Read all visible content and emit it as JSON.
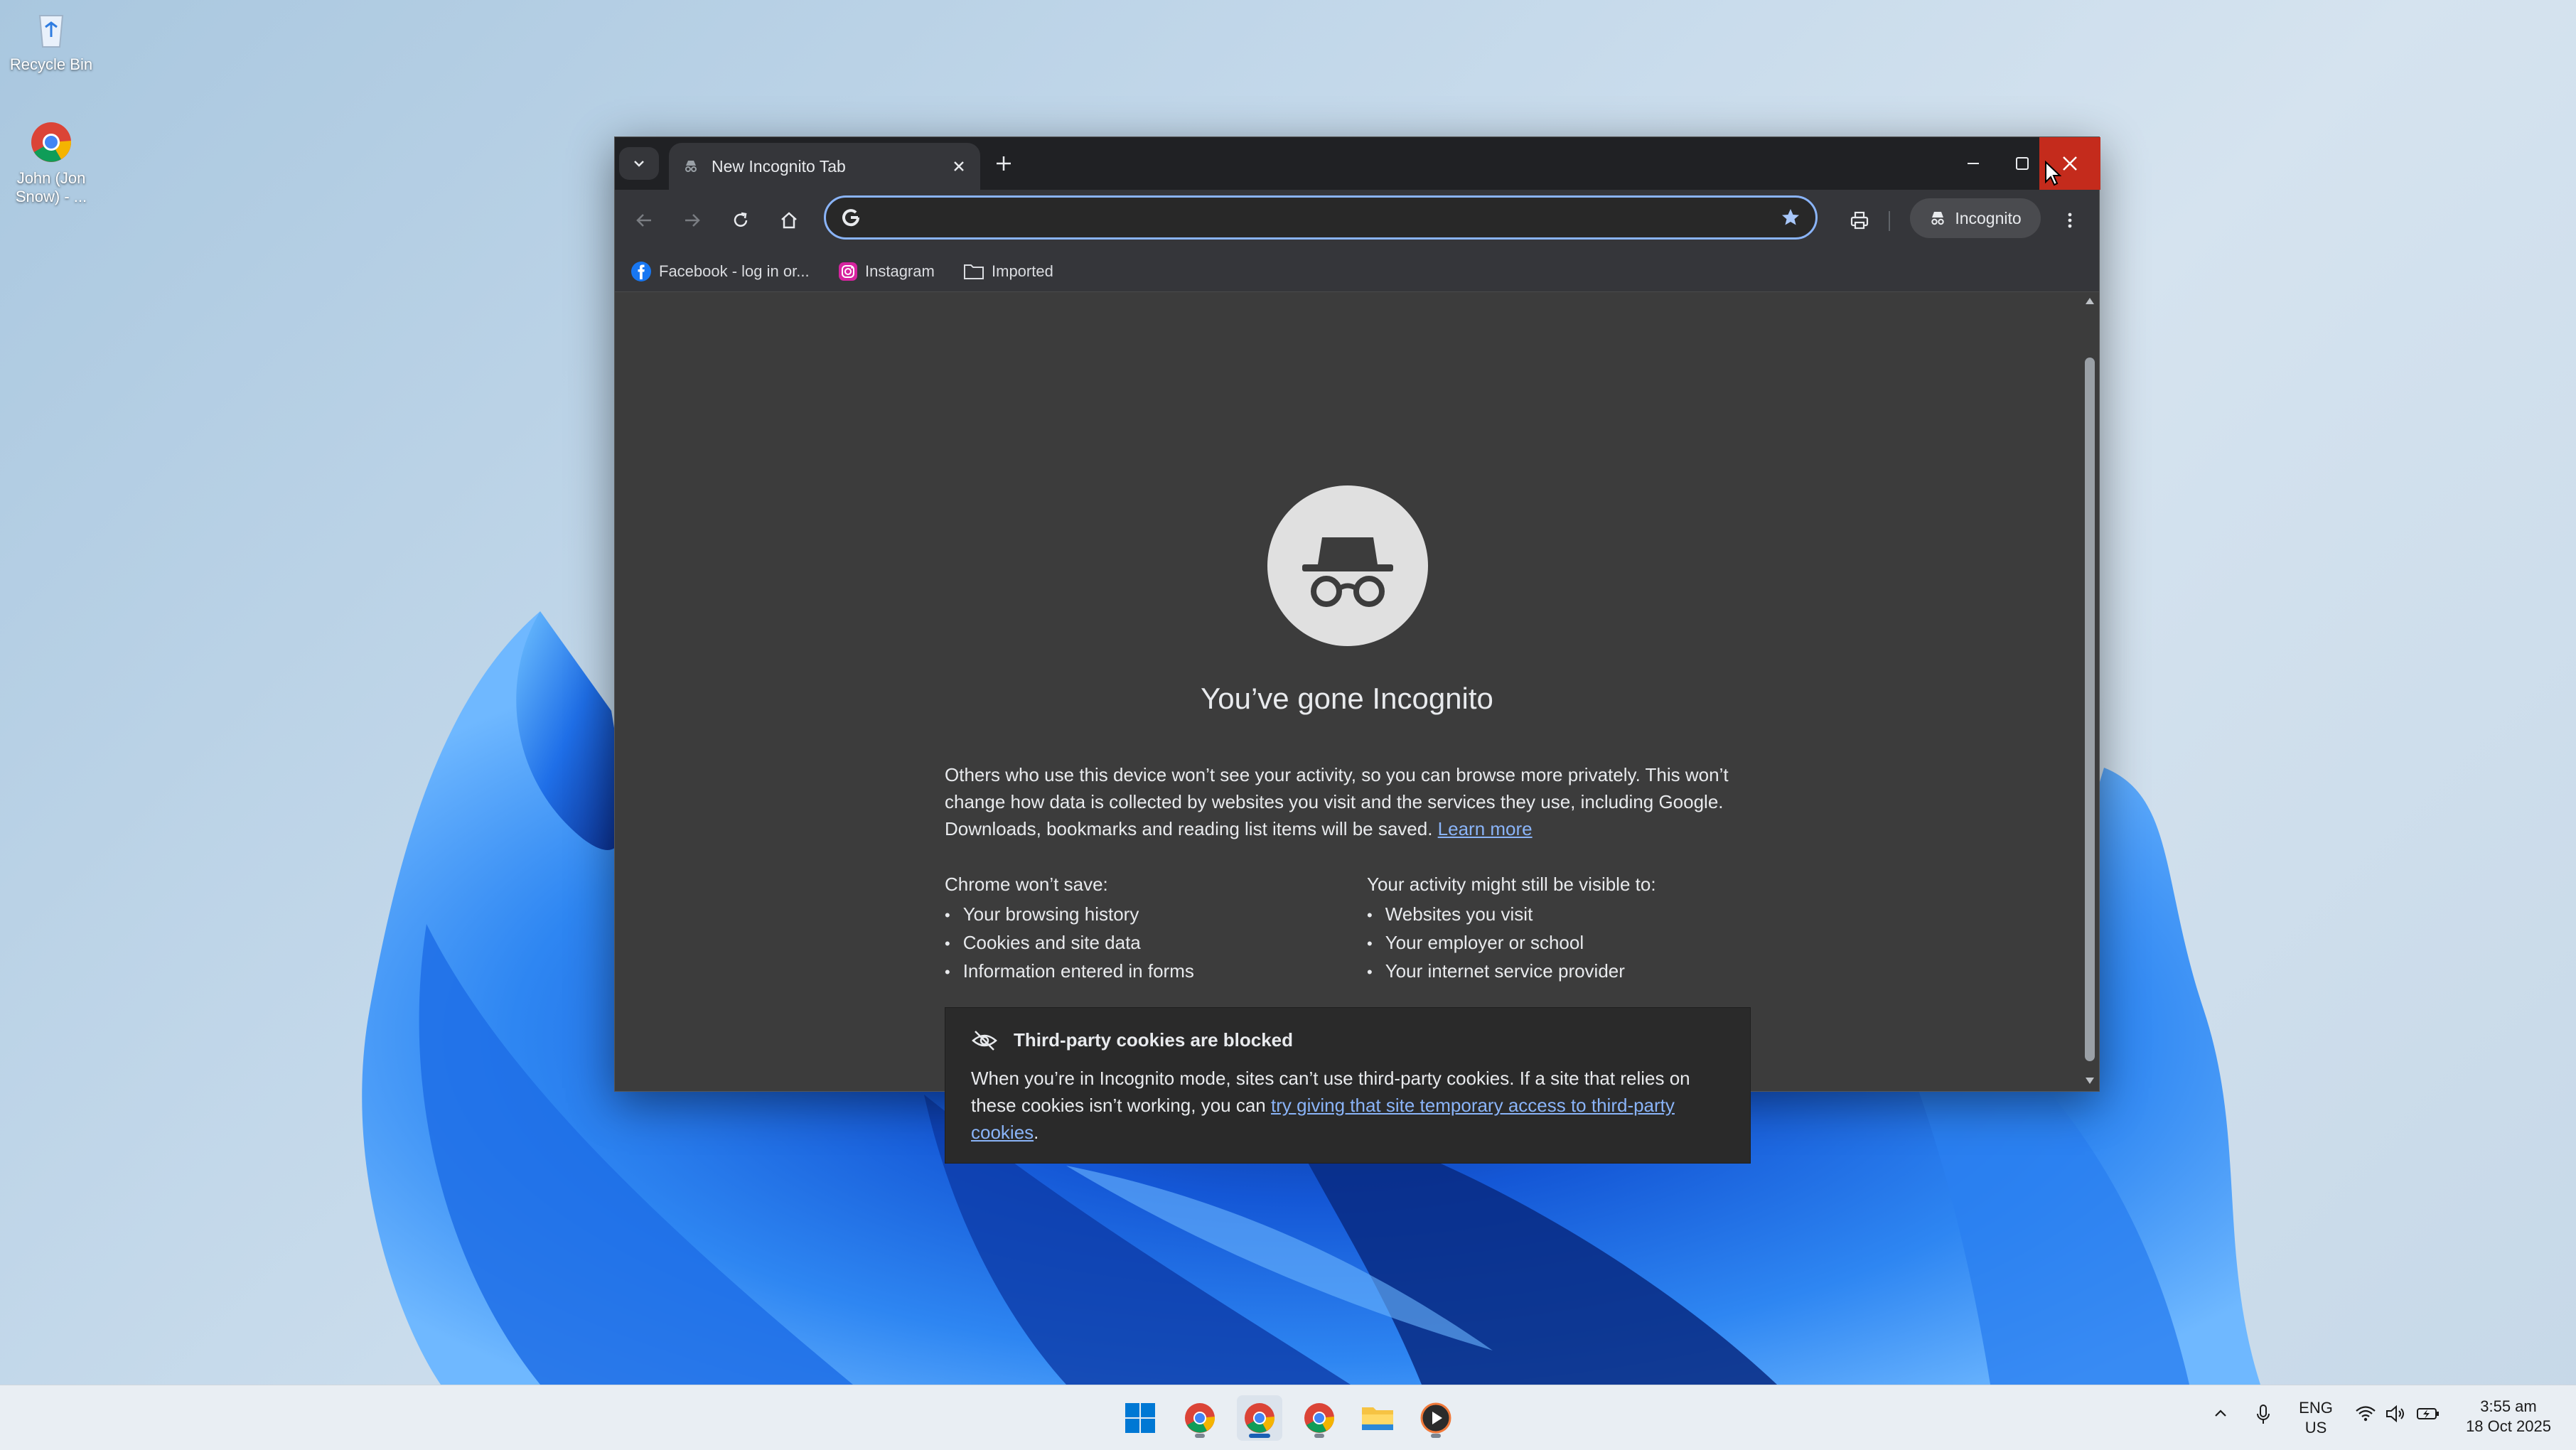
{
  "desktop": {
    "icons": [
      {
        "label": "Recycle Bin",
        "icon": "recycle-bin-icon"
      },
      {
        "label": "John (Jon Snow) - ...",
        "icon": "chrome-profile-icon"
      }
    ]
  },
  "browser": {
    "tab": {
      "title": "New Incognito Tab",
      "icon": "incognito-icon"
    },
    "window_controls": {
      "minimize": "minimize-icon",
      "maximize": "maximize-icon",
      "close": "close-icon"
    },
    "toolbar": {
      "omnibox_value": "",
      "omnibox_placeholder": "",
      "incognito_label": "Incognito"
    },
    "bookmarks": [
      {
        "label": "Facebook - log in or...",
        "icon": "facebook-icon"
      },
      {
        "label": "Instagram",
        "icon": "instagram-icon"
      },
      {
        "label": "Imported",
        "icon": "folder-icon"
      }
    ],
    "page": {
      "heading": "You’ve gone Incognito",
      "intro": "Others who use this device won’t see your activity, so you can browse more privately. This won’t change how data is collected by websites you visit and the services they use, including Google. Downloads, bookmarks and reading list items will be saved.",
      "learn_more": "Learn more",
      "wont_save_title": "Chrome won’t save:",
      "wont_save": [
        "Your browsing history",
        "Cookies and site data",
        "Information entered in forms"
      ],
      "visible_title": "Your activity might still be visible to:",
      "visible": [
        "Websites you visit",
        "Your employer or school",
        "Your internet service provider"
      ],
      "cookies_title": "Third-party cookies are blocked",
      "cookies_text": "When you’re in Incognito mode, sites can’t use third-party cookies. If a site that relies on these cookies isn’t working, you can",
      "cookies_link": "try giving that site temporary access to third-party cookies",
      "cookies_end": "."
    }
  },
  "taskbar": {
    "apps": [
      "windows-start-icon",
      "chrome-icon",
      "chrome-icon",
      "chrome-icon",
      "file-explorer-icon",
      "media-player-icon"
    ],
    "language": "ENG",
    "region": "US",
    "time": "3:55 am",
    "date": "18 Oct 2025"
  },
  "colors": {
    "accent": "#8ab4f8",
    "close_red": "#c42b1c",
    "frame": "#202124",
    "page_bg": "#3c3c3c"
  }
}
